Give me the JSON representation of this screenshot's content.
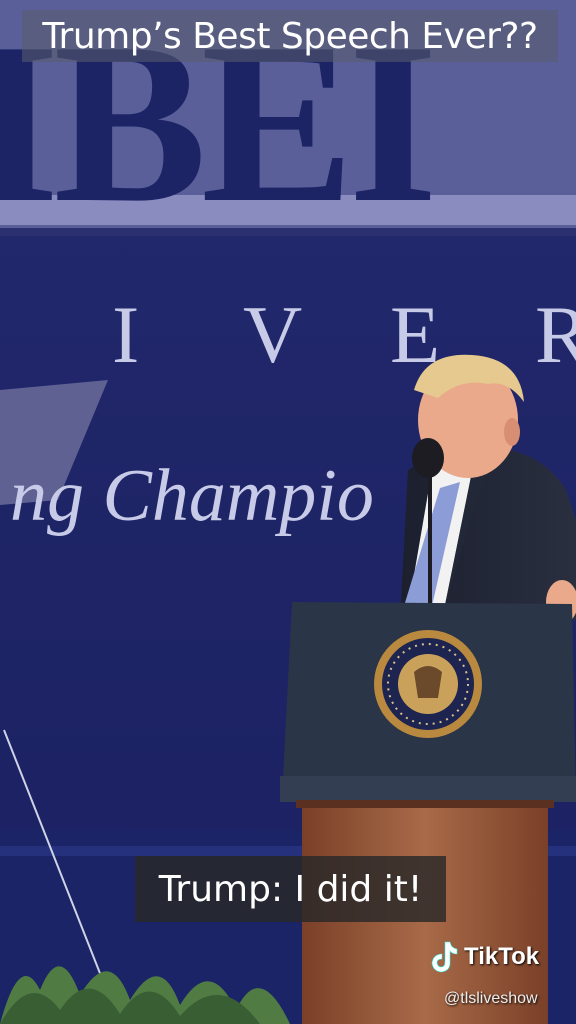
{
  "video": {
    "title": "Trump’s Best Speech Ever??",
    "caption": "Trump: I did it!"
  },
  "backdrop": {
    "letters_big": "IBEI",
    "letters_university": [
      "I",
      "V",
      "E",
      "R"
    ],
    "script": "ng Champio"
  },
  "watermark": {
    "brand": "TikTok",
    "handle": "@tlsliveshow",
    "icon": "tiktok-note-icon"
  },
  "colors": {
    "banner_blue": "#1c2566",
    "banner_band": "#4a4f8c",
    "podium_navy": "#2a3548",
    "podium_wood": "#9a5a3a",
    "caption_bg": "#282828"
  }
}
